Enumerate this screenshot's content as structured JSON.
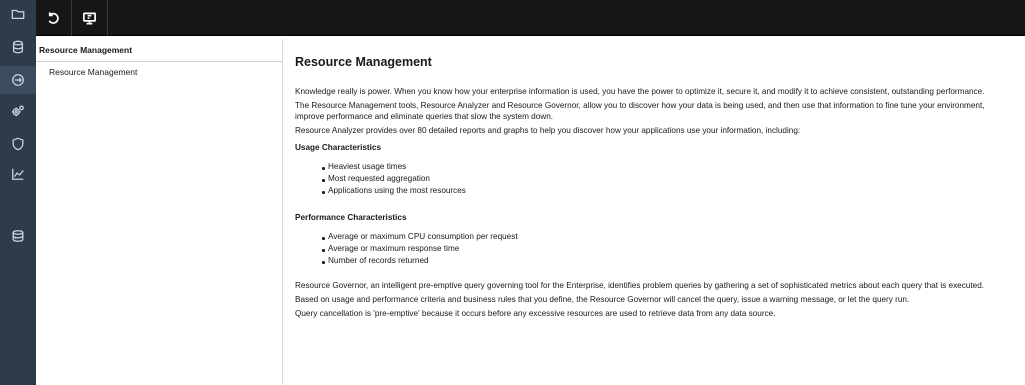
{
  "tree": {
    "header": "Resource Management",
    "items": [
      "Resource Management"
    ]
  },
  "rail_icons": [
    "folder-icon",
    "database-icon",
    "gauge-icon",
    "gears-icon",
    "shield-icon",
    "chart-icon",
    "storage-icon"
  ],
  "toolbar_icons": [
    "refresh-icon",
    "monitor-icon"
  ],
  "content": {
    "title": "Resource Management",
    "p1": "Knowledge really is power. When you know how your enterprise information is used, you have the power to optimize it, secure it, and modify it to achieve consistent, outstanding performance.",
    "p2": "The Resource Management tools, Resource Analyzer and Resource Governor, allow you to discover how your data is being used, and then use that information to fine tune your environment, improve performance and eliminate queries that slow the system down.",
    "p3": "Resource Analyzer provides over 80 detailed reports and graphs to help you discover how your applications use your information, including:",
    "usage_heading": "Usage Characteristics",
    "usage_items": [
      "Heaviest usage times",
      "Most requested aggregation",
      "Applications using the most resources"
    ],
    "perf_heading": "Performance Characteristics",
    "perf_items": [
      "Average or maximum CPU consumption per request",
      "Average or maximum response time",
      "Number of records returned"
    ],
    "p4": "Resource Governor, an intelligent pre-emptive query governing tool for the Enterprise, identifies problem queries by gathering a set of sophisticated metrics about each query that is executed.",
    "p5": "Based on usage and performance criteria and business rules that you define, the Resource Governor will cancel the query, issue a warning message, or let the query run.",
    "p6": "Query cancellation is 'pre-emptive' because it occurs before any excessive resources are used to retrieve data from any data source."
  },
  "colors": {
    "rail": "#2e3b4a",
    "toolbar": "#161616",
    "accent": "#3c4d60"
  }
}
